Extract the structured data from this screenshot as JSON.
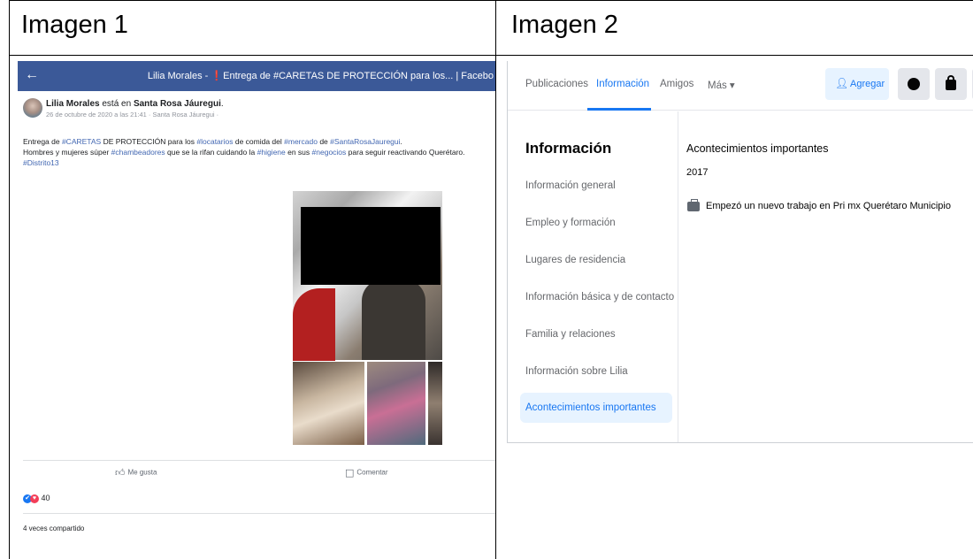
{
  "cells": {
    "image1_title": "Imagen 1",
    "image2_title": "Imagen 2"
  },
  "fb_post": {
    "window_title": "Lilia Morales - ",
    "window_title_rest": "Entrega de #CARETAS DE PROTECCIÓN para los... | Facebo",
    "author": "Lilia Morales",
    "is_at": " está en ",
    "place": "Santa Rosa Jáuregui",
    "date_line": "26 de octubre de 2020 a las 21:41 · Santa Rosa Jáuregui · ",
    "text_lines": [
      {
        "parts": [
          {
            "t": "Entrega de ",
            "c": "plain"
          },
          {
            "t": "#CARETAS",
            "c": "tag"
          },
          {
            "t": " DE PROTECCIÓN para los ",
            "c": "plain"
          },
          {
            "t": "#locatarios",
            "c": "tag"
          },
          {
            "t": " de ",
            "c": "plain"
          },
          {
            "t": "comida del ",
            "c": "plain"
          },
          {
            "t": "#mercado",
            "c": "tag"
          },
          {
            "t": " de ",
            "c": "plain"
          },
          {
            "t": "#SantaRosaJauregui",
            "c": "tag"
          },
          {
            "t": ".",
            "c": "plain"
          }
        ]
      },
      {
        "parts": [
          {
            "t": "Hombres y mujeres súper ",
            "c": "plain"
          },
          {
            "t": "#chambeadores",
            "c": "tag"
          },
          {
            "t": " que se la rifan cuidando la ",
            "c": "plain"
          },
          {
            "t": "#higiene",
            "c": "tag"
          },
          {
            "t": " en sus ",
            "c": "plain"
          },
          {
            "t": "#negocios",
            "c": "tag"
          },
          {
            "t": " para seguir reactivando Querétaro.",
            "c": "plain"
          }
        ]
      },
      {
        "parts": [
          {
            "t": "#Distrito13",
            "c": "tag"
          }
        ]
      }
    ],
    "like_label": "Me gusta",
    "comment_label": "Comentar",
    "reaction_count": "40",
    "shares": "4 veces compartido"
  },
  "profile": {
    "tabs": [
      "Publicaciones",
      "Información",
      "Amigos",
      "Más ▾"
    ],
    "active_tab": "Información",
    "add_button": "Agregar",
    "more_button": "···",
    "sidebar_title": "Información",
    "sidebar_items": [
      "Información general",
      "Empleo y formación",
      "Lugares de residencia",
      "Información básica y de contacto",
      "Familia y relaciones",
      "Información sobre Lilia",
      "Acontecimientos importantes"
    ],
    "active_item": "Acontecimientos importantes",
    "section_title": "Acontecimientos importantes",
    "year": "2017",
    "event": "Empezó un nuevo trabajo en Pri mx Querétaro Municipio"
  },
  "colors": {
    "facebook_bar": "#3b5998",
    "link": "#4267b2",
    "active_blue": "#1877f2",
    "active_bg": "#e7f3ff"
  },
  "icons": [
    "back-arrow-icon",
    "like-icon",
    "comment-icon",
    "like-reaction-icon",
    "love-reaction-icon",
    "add-friend-icon",
    "messenger-icon",
    "lock-icon",
    "briefcase-icon"
  ]
}
